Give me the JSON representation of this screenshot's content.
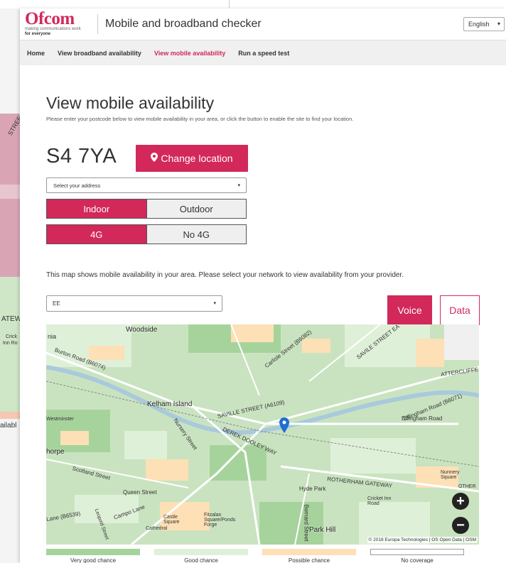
{
  "background_window": {
    "fragments": [
      "STREE",
      "ATEW",
      "Crick",
      "Inn Ro",
      "ailabl"
    ]
  },
  "header": {
    "logo_name": "Ofcom",
    "logo_tagline": "making communications work",
    "logo_tagline2": "for everyone",
    "title": "Mobile and broadband checker",
    "language": "English"
  },
  "nav": {
    "items": [
      {
        "label": "Home"
      },
      {
        "label": "View broadband availability"
      },
      {
        "label": "View mobile availability",
        "active": true
      },
      {
        "label": "Run a speed test"
      }
    ]
  },
  "main": {
    "heading": "View mobile availability",
    "intro": "Please enter your postcode below to view mobile availability in your area, or click the button to enable the site to find your location.",
    "postcode": "S4 7YA",
    "change_location_label": "Change location",
    "address_placeholder": "Select your address",
    "location_toggle": {
      "on": "Indoor",
      "off": "Outdoor"
    },
    "network_toggle": {
      "on": "4G",
      "off": "No 4G"
    },
    "map_description": "This map shows mobile availability in your area. Please select your network to view availability from your provider.",
    "network_selected": "EE",
    "voice_label": "Voice",
    "data_label": "Data"
  },
  "map": {
    "labels": {
      "woodside": "Woodside",
      "nia": "nia",
      "burton_road": "Burton Road (B6074)",
      "carlisle_street": "Carlisle Street (B6082)",
      "saville_street_east": "SAVILE STREET EA",
      "attercliffe": "ATTERCLIFFE R",
      "kelham_island": "Kelham Island",
      "saville_street": "SAVILLE STREET (A6109)",
      "effingham_road": "Effingham Road (B6071)",
      "effingham_road2": "Effingham Road",
      "nursery_street": "Nursery Street",
      "derek_dooley_way": "DEREK DOOLEY WAY",
      "thorpe": "horpe",
      "scotland_street": "Scotland Street",
      "queen_street": "Queen Street",
      "campo_lane": "Campo Lane",
      "hyde_park": "Hyde Park",
      "rotherham_gateway": "ROTHERHAM GATEWAY",
      "nunnery_square": "Nunnery Square",
      "cricket_inn_road": "Cricket Inn Road",
      "park_hill": "Park Hill",
      "bernard_street": "Bernard Street",
      "lane_b6539": "Lane (B6539)",
      "cathedral": "Cathedral",
      "castle_square": "Castle Square",
      "fitzalan": "Fitzalan Square/Ponds Forge",
      "westminster": "Westminster",
      "leopold_street": "Leopold Street",
      "other": "OTHER"
    },
    "attribution": "© 2018 Europa Technologies | OS Open Data | OSM",
    "zoom_in": "+",
    "zoom_out": "−"
  },
  "legend": [
    {
      "label": "Very good chance",
      "color": "#a6d39c"
    },
    {
      "label": "Good chance",
      "color": "#dff0d8"
    },
    {
      "label": "Possible chance",
      "color": "#fde0b5"
    },
    {
      "label": "No coverage",
      "color": "#ffffff"
    }
  ],
  "colors": {
    "brand": "#d2285a",
    "map_very_good": "#a6d39c",
    "map_good": "#dff0d8",
    "map_possible": "#fde0b5"
  }
}
